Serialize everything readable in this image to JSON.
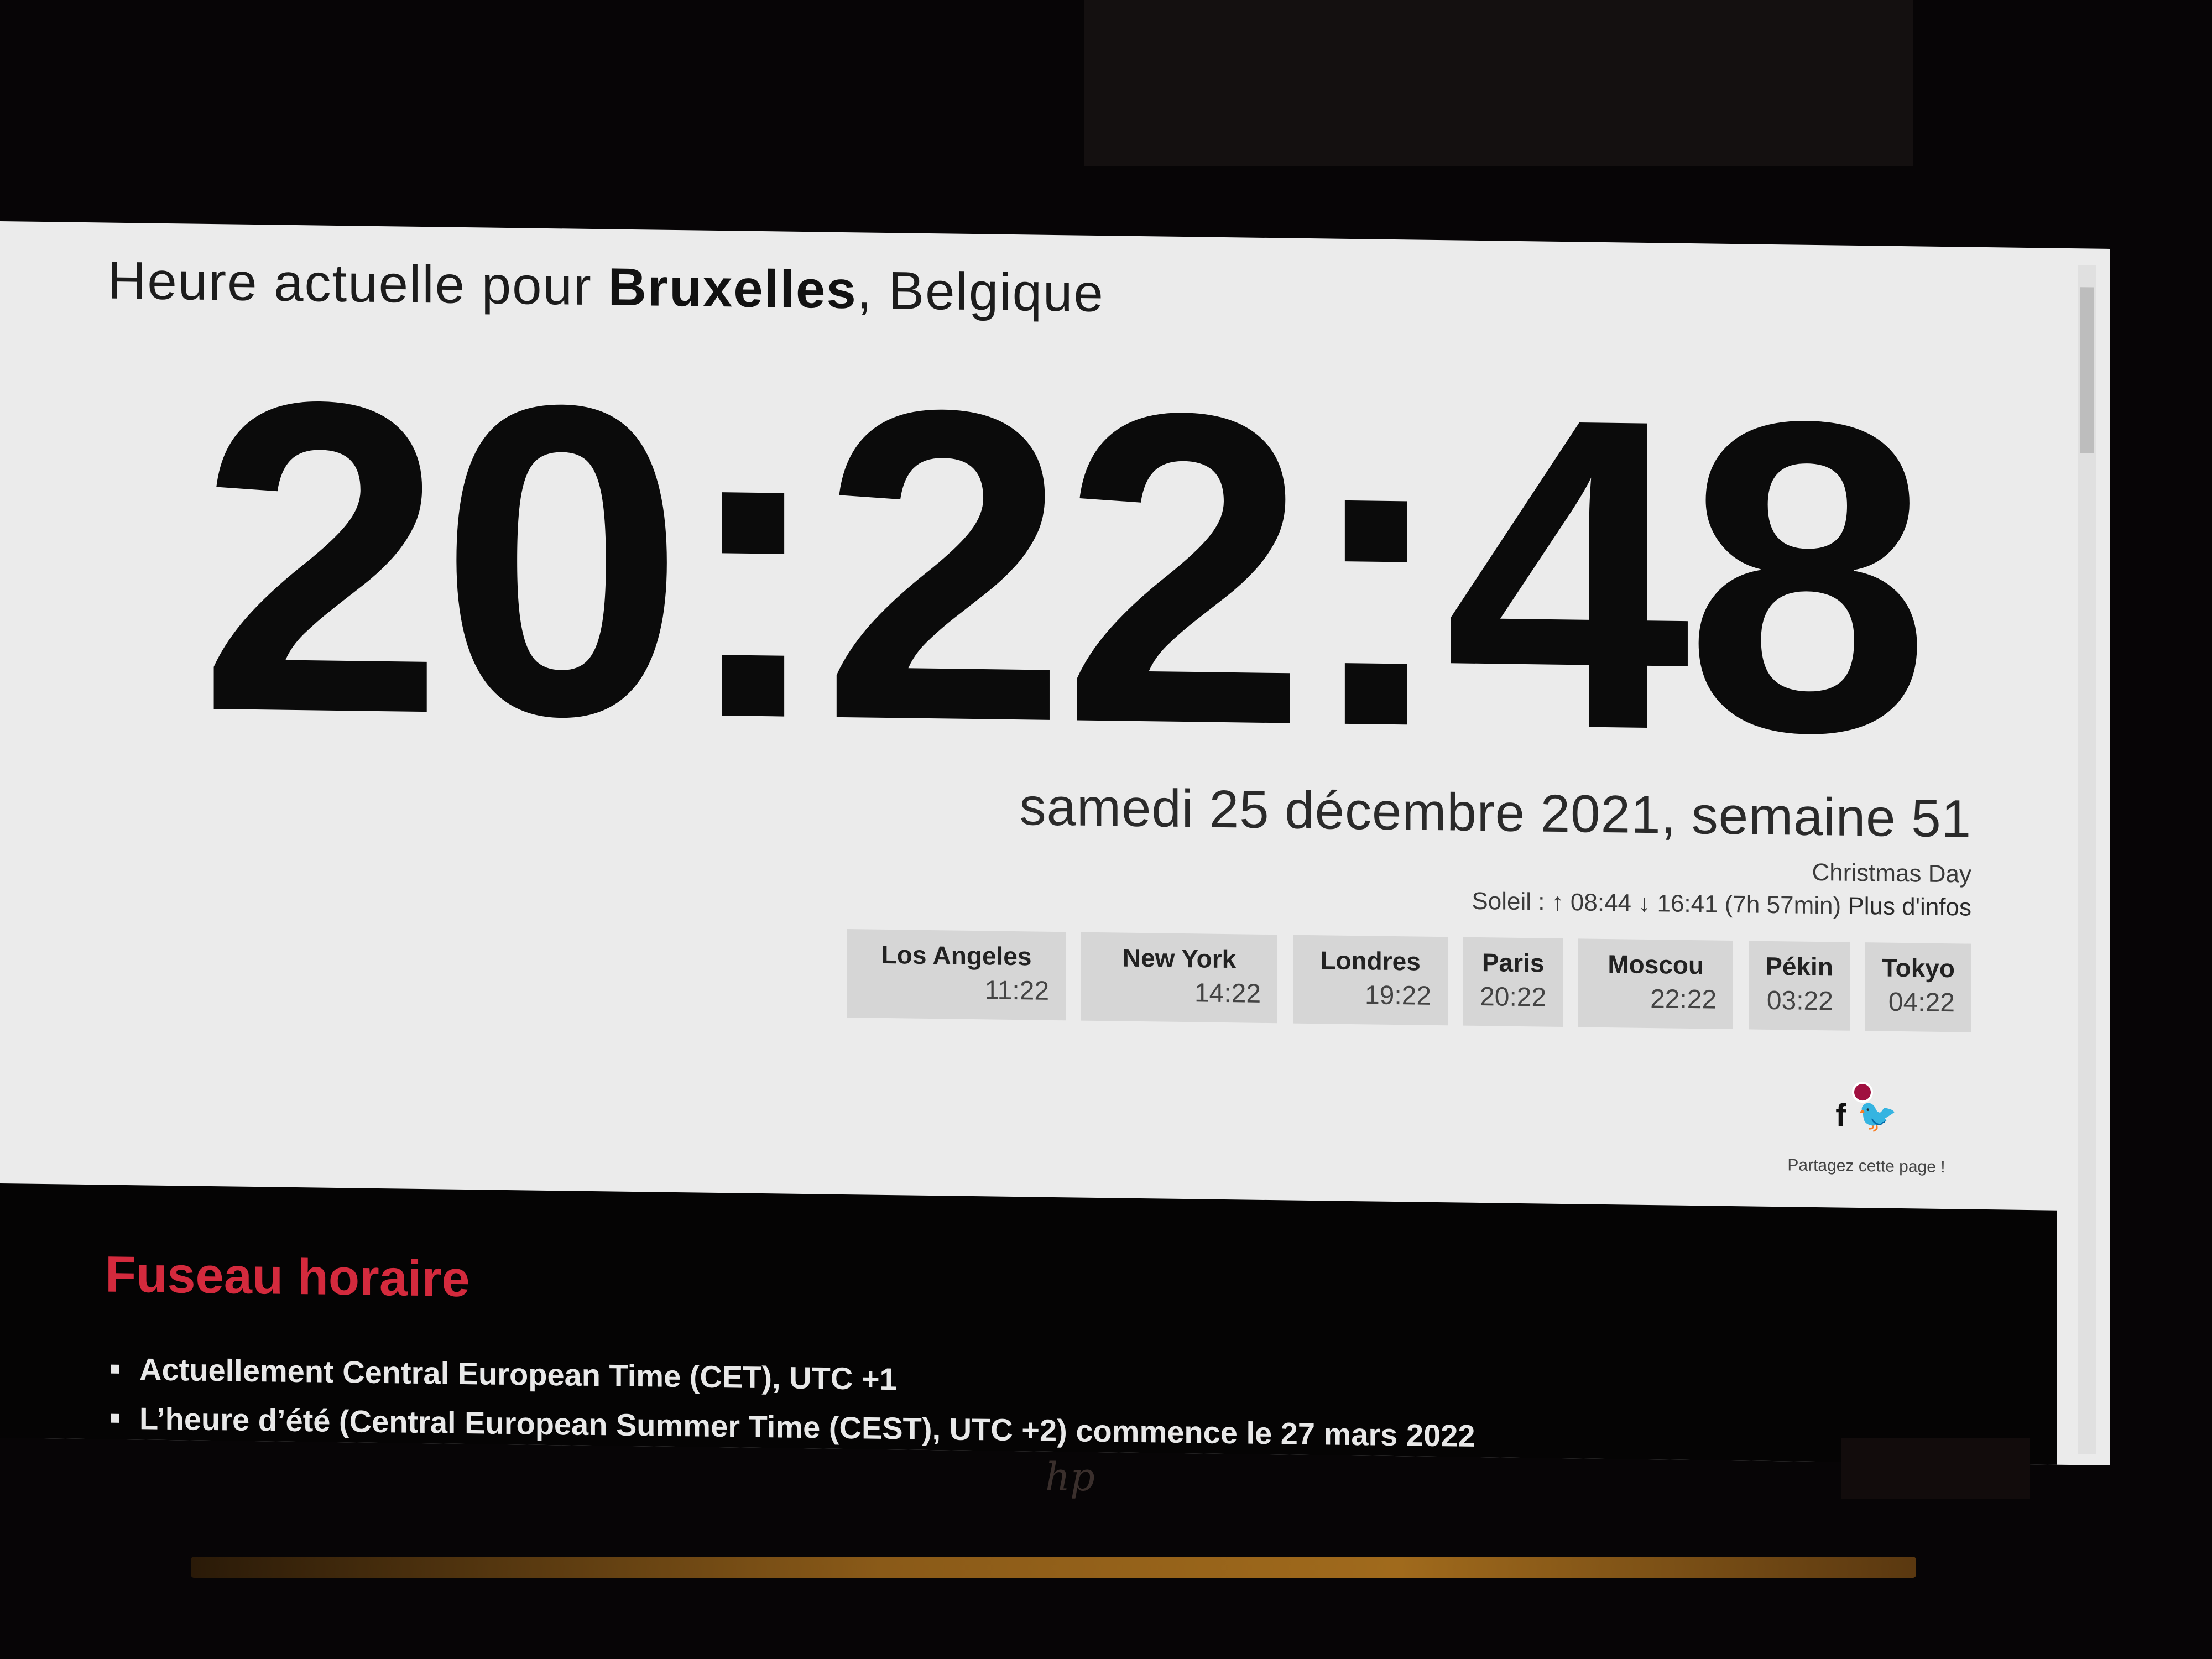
{
  "header": {
    "prefix": "Heure actuelle pour",
    "city": "Bruxelles",
    "country_suffix": ", Belgique"
  },
  "clock": {
    "time": "20:22:48"
  },
  "date": {
    "line": "samedi 25 décembre 2021, semaine 51",
    "holiday": "Christmas Day",
    "sun": "Soleil : ↑ 08:44 ↓ 16:41 (7h 57min)",
    "more_info": "Plus d'infos"
  },
  "cities": [
    {
      "name": "Los Angeles",
      "time": "11:22"
    },
    {
      "name": "New York",
      "time": "14:22"
    },
    {
      "name": "Londres",
      "time": "19:22"
    },
    {
      "name": "Paris",
      "time": "20:22"
    },
    {
      "name": "Moscou",
      "time": "22:22"
    },
    {
      "name": "Pékin",
      "time": "03:22"
    },
    {
      "name": "Tokyo",
      "time": "04:22"
    }
  ],
  "share": {
    "facebook_glyph": "f",
    "twitter_glyph": "🐦",
    "label": "Partagez cette page !"
  },
  "timezone": {
    "title": "Fuseau horaire",
    "items": [
      "Actuellement Central European Time (CET), UTC +1",
      "L’heure d’été (Central European Summer Time (CEST), UTC +2) commence le 27 mars 2022"
    ]
  },
  "device": {
    "brand_logo": "hp"
  },
  "colors": {
    "accent_red": "#d42a3d",
    "page_bg": "#ebebeb",
    "dark_section_bg": "#050404"
  }
}
